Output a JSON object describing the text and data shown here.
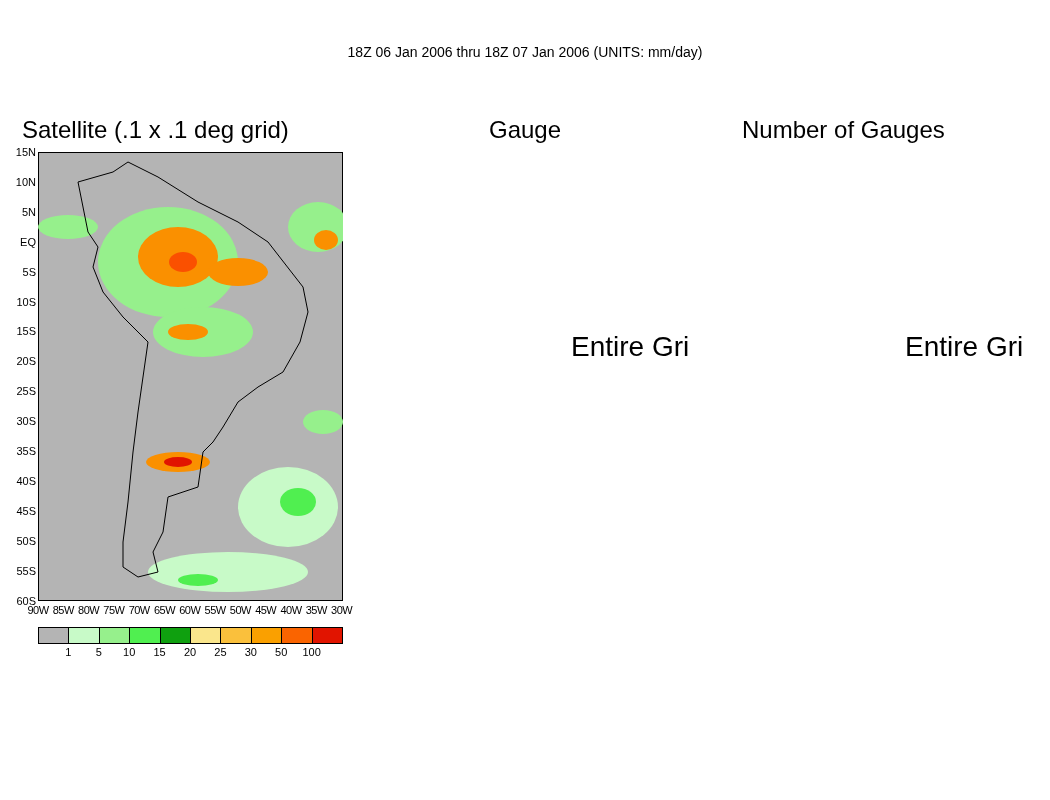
{
  "header": "18Z 06 Jan 2006 thru 18Z 07 Jan 2006 (UNITS: mm/day)",
  "panels": [
    {
      "title": "Satellite (.1 x .1 deg grid)",
      "kind": "map"
    },
    {
      "title": "Gauge",
      "kind": "missing",
      "message": "Entire Gri"
    },
    {
      "title": "Number of Gauges",
      "kind": "missing",
      "message": "Entire Gri"
    }
  ],
  "lat_labels": [
    "15N",
    "10N",
    "5N",
    "EQ",
    "5S",
    "10S",
    "15S",
    "20S",
    "25S",
    "30S",
    "35S",
    "40S",
    "45S",
    "50S",
    "55S",
    "60S"
  ],
  "lon_labels": [
    "90W",
    "85W",
    "80W",
    "75W",
    "70W",
    "65W",
    "60W",
    "55W",
    "50W",
    "45W",
    "40W",
    "35W",
    "30W"
  ],
  "legend": [
    {
      "color": "#b4b4b4"
    },
    {
      "color": "#c8fac8",
      "label": "1"
    },
    {
      "color": "#96f08c",
      "label": "5"
    },
    {
      "color": "#50ef50",
      "label": "10"
    },
    {
      "color": "#0fa00f",
      "label": "15"
    },
    {
      "color": "#fae68c",
      "label": "20"
    },
    {
      "color": "#fac03c",
      "label": "25"
    },
    {
      "color": "#faa000",
      "label": "30"
    },
    {
      "color": "#fa6400",
      "label": "50"
    },
    {
      "color": "#e11400",
      "label": "100"
    }
  ]
}
